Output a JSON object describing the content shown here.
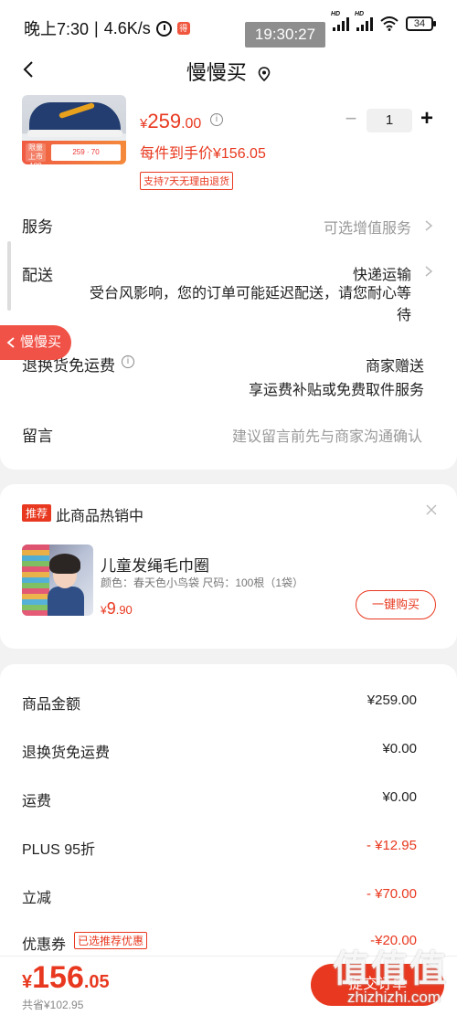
{
  "status_bar": {
    "time": "晚上7:30",
    "network_speed": "4.6K/s",
    "overlay_time": "19:30:27",
    "signal_label": "HD",
    "battery": "34"
  },
  "nav": {
    "title": "慢慢买"
  },
  "product": {
    "price_currency": "¥",
    "price_int": "259",
    "price_dec": ".00",
    "final_price": "每件到手价¥156.05",
    "quantity": "1",
    "return_tag": "支持7天无理由退货",
    "image_tag_left": "限量上市 189",
    "image_tag_right": "259 · 70"
  },
  "rows": {
    "service_label": "服务",
    "service_value": "可选增值服务",
    "delivery_label": "配送",
    "delivery_value": "快递运输",
    "delivery_notice": "受台风影响，您的订单可能延迟配送，请您耐心等待",
    "return_label": "退换货免运费",
    "return_value": "商家赠送",
    "return_desc": "享运费补贴或免费取件服务",
    "message_label": "留言",
    "message_placeholder": "建议留言前先与商家沟通确认"
  },
  "float_tab": {
    "label": "慢慢买"
  },
  "recommend": {
    "badge": "推荐",
    "title": "此商品热销中",
    "name": "儿童发绳毛巾圈",
    "spec": "颜色：春天色小鸟袋   尺码：100根（1袋）",
    "price_currency": "¥",
    "price_int": "9",
    "price_dec": ".90",
    "buy_label": "一键购买"
  },
  "summary": [
    {
      "label": "商品金额",
      "value": "¥259.00",
      "red": false
    },
    {
      "label": "退换货免运费",
      "value": "¥0.00",
      "red": false
    },
    {
      "label": "运费",
      "value": "¥0.00",
      "red": false
    },
    {
      "label": "PLUS 95折",
      "value": "- ¥12.95",
      "red": true
    },
    {
      "label": "立减",
      "value": "- ¥70.00",
      "red": true
    },
    {
      "label": "优惠券",
      "value": "-¥20.00",
      "red": true
    }
  ],
  "coupon_tag": "已选推荐优惠",
  "bottom": {
    "total_currency": "¥",
    "total_int": "156",
    "total_dec": ".05",
    "saved": "共省¥102.95",
    "submit_label": "提交订单"
  },
  "watermark": {
    "main": "值值值",
    "sub": "zhizhizhi.com"
  },
  "colors": {
    "accent": "#e8381f",
    "background": "#f2f2f2"
  }
}
